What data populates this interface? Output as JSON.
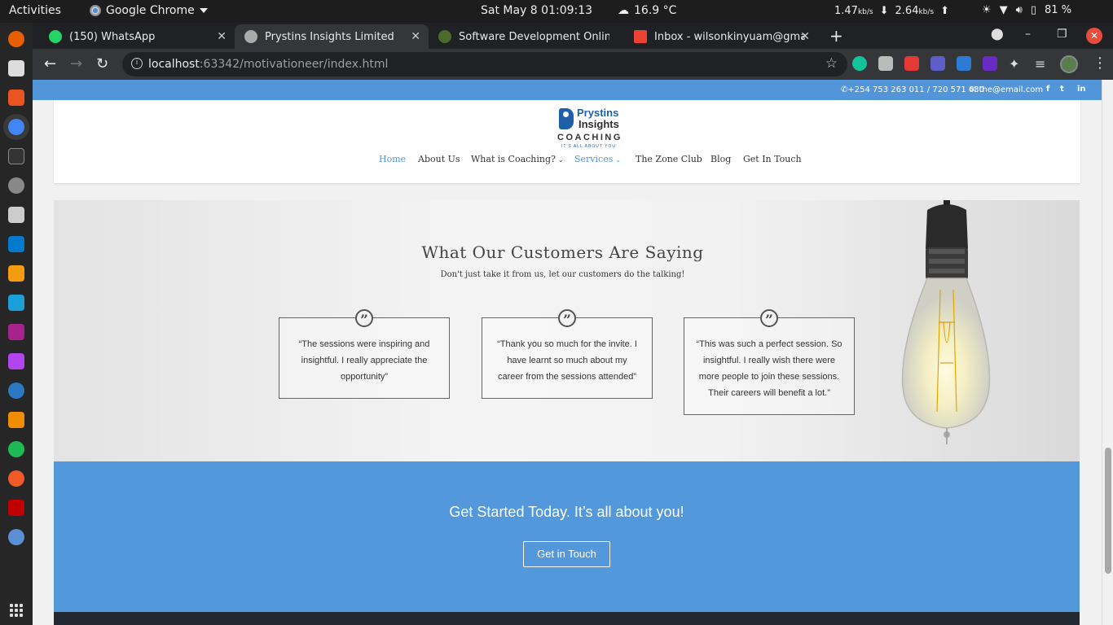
{
  "system": {
    "activities": "Activities",
    "app_name": "Google Chrome",
    "clock": "Sat May 8  01:09:13",
    "weather": "16.9 °C",
    "net_down": "1.47",
    "net_down_unit": "kb/s",
    "net_up": "2.64",
    "net_up_unit": "kb/s",
    "battery": "81 %"
  },
  "tabs": [
    {
      "title": "(150) WhatsApp",
      "active": false,
      "favicon_color": "#25d366"
    },
    {
      "title": "Prystins Insights Limited",
      "active": true,
      "favicon_color": "#aaaaaa"
    },
    {
      "title": "Software Development Online |",
      "active": false,
      "favicon_color": "#4a6b2a"
    },
    {
      "title": "Inbox - wilsonkinyuam@gmail.co",
      "active": false,
      "favicon_color": "#ea4335"
    }
  ],
  "url": {
    "host": "localhost",
    "path": ":63342/motivationeer/index.html"
  },
  "site": {
    "contact": {
      "phone": "+254 753 263 011 / 720 571 630",
      "email": "the@email.com",
      "social": [
        "f",
        "t",
        "in"
      ]
    },
    "logo": {
      "line1": "Prystins",
      "line2": "Insights",
      "line3": "COACHING",
      "tagline": "IT'S ALL ABOUT YOU"
    },
    "menu": [
      {
        "label": "Home",
        "active": true,
        "dropdown": false
      },
      {
        "label": "About Us",
        "active": false,
        "dropdown": false
      },
      {
        "label": "What is Coaching?",
        "active": false,
        "dropdown": true
      },
      {
        "label": "Services",
        "active": true,
        "dropdown": true
      },
      {
        "label": "The Zone Club",
        "active": false,
        "dropdown": false
      },
      {
        "label": "Blog",
        "active": false,
        "dropdown": false
      },
      {
        "label": "Get In Touch",
        "active": false,
        "dropdown": false
      }
    ],
    "testimonials": {
      "heading": "What Our Customers Are Saying",
      "subheading": "Don't just take it from us, let our customers do the talking!",
      "quotes": [
        "“The sessions were inspiring and insightful. I really appreciate the opportunity”",
        "“Thank you so much for the invite. I have learnt so much about my career from the sessions attended”",
        "“This was such a perfect session. So insightful. I really wish there were more people to join these sessions. Their careers will benefit a lot.”"
      ]
    },
    "cta": {
      "title": "Get Started Today. It’s all about you!",
      "button": "Get in Touch"
    }
  },
  "colors": {
    "accent": "#5296d9",
    "footer": "#222930"
  }
}
